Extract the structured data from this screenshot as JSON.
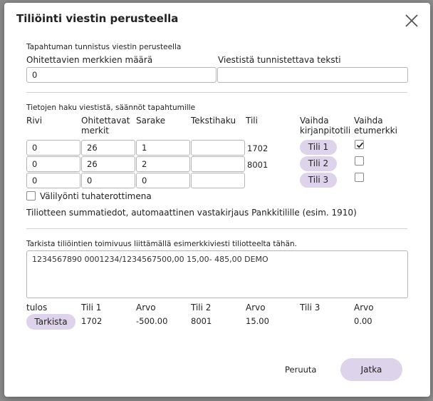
{
  "dialog": {
    "title": "Tiliöinti viestin perusteella"
  },
  "identification": {
    "section_label": "Tapahtuman tunnistus viestin perusteella",
    "skip_chars_label": "Ohitettavien merkkien määrä",
    "skip_chars_value": "0",
    "identify_text_label": "Viestistä tunnistettava teksti",
    "identify_text_value": ""
  },
  "rules": {
    "section_label": "Tietojen haku viestistä, säännöt tapahtumille",
    "headers": {
      "row": "Rivi",
      "skip_line1": "Ohitettavat",
      "skip_line2": "merkit",
      "column": "Sarake",
      "text_search": "Tekstihaku",
      "account": "Tili",
      "swap_line1": "Vaihda",
      "swap_line2": "kirjanpitotili",
      "sign_line1": "Vaihda",
      "sign_line2": "etumerkki"
    },
    "rows": [
      {
        "row": "0",
        "skip": "26",
        "column": "1",
        "text": "",
        "account": "1702",
        "swap_label": "Tili 1",
        "sign_checked": true
      },
      {
        "row": "0",
        "skip": "26",
        "column": "2",
        "text": "",
        "account": "8001",
        "swap_label": "Tili 2",
        "sign_checked": false
      },
      {
        "row": "0",
        "skip": "0",
        "column": "0",
        "text": "",
        "account": "",
        "swap_label": "Tili 3",
        "sign_checked": false
      }
    ],
    "thousands_sep_label": "Välilyönti tuhaterottimena",
    "thousands_sep_checked": false,
    "summary_text": "Tiliotteen summatiedot, automaattinen vastakirjaus Pankkitilille (esim. 1910)"
  },
  "check": {
    "section_label": "Tarkista tiliöintien toimivuus liittämällä esimerkkiviesti tiliotteelta tähän.",
    "sample_message": "1234567890 0001234/1234567500,00 15,00- 485,00 DEMO",
    "headers": {
      "result": "tulos",
      "account1": "Tili 1",
      "value1": "Arvo",
      "account2": "Tili 2",
      "value2": "Arvo",
      "account3": "Tili 3",
      "value3": "Arvo"
    },
    "check_button": "Tarkista",
    "values": {
      "account1": "1702",
      "value1": "-500.00",
      "account2": "8001",
      "value2": "15.00",
      "account3": "",
      "value3": "0.00"
    }
  },
  "footer": {
    "cancel_label": "Peruuta",
    "continue_label": "Jatka"
  }
}
